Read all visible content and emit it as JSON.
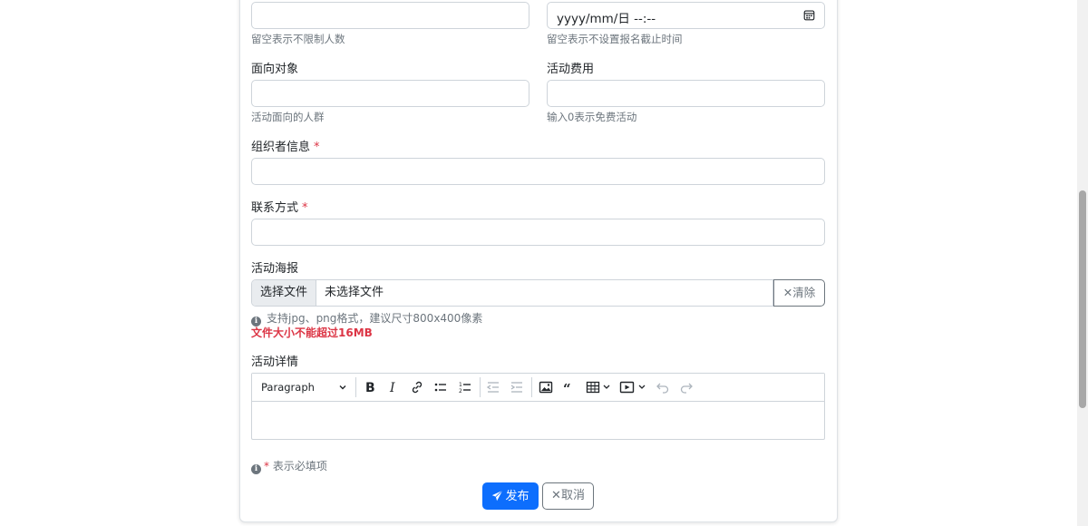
{
  "form": {
    "max_participants": {
      "value": "",
      "help": "留空表示不限制人数"
    },
    "deadline": {
      "value": "yyyy/mm/日 --:--",
      "help": "留空表示不设置报名截止时间"
    },
    "audience": {
      "label": "面向对象",
      "value": "",
      "help": "活动面向的人群"
    },
    "fee": {
      "label": "活动费用",
      "value": "",
      "help": "输入0表示免费活动"
    },
    "organizer": {
      "label": "组织者信息",
      "required_mark": "*",
      "value": ""
    },
    "contact": {
      "label": "联系方式",
      "required_mark": "*",
      "value": ""
    },
    "poster": {
      "label": "活动海报",
      "choose_label": "选择文件",
      "file_name": "未选择文件",
      "clear_label": "清除",
      "hint": "支持jpg、png格式，建议尺寸800x400像素",
      "error": "文件大小不能超过16MB"
    },
    "details": {
      "label": "活动详情",
      "paragraph_label": "Paragraph"
    },
    "required_note": {
      "mark": "*",
      "text": "表示必填项"
    },
    "publish_label": "发布",
    "cancel_label": "取消"
  },
  "colors": {
    "primary": "#0d6efd",
    "danger": "#dc3545",
    "muted": "#6c757d",
    "border": "#ced4da"
  },
  "icons": [
    "calendar-icon",
    "clear-x-icon",
    "info-icon",
    "bold-icon",
    "italic-icon",
    "link-icon",
    "bulleted-list-icon",
    "numbered-list-icon",
    "outdent-icon",
    "indent-icon",
    "image-icon",
    "quote-icon",
    "table-icon",
    "media-icon",
    "undo-icon",
    "redo-icon",
    "paper-plane-icon",
    "cancel-x-icon"
  ]
}
